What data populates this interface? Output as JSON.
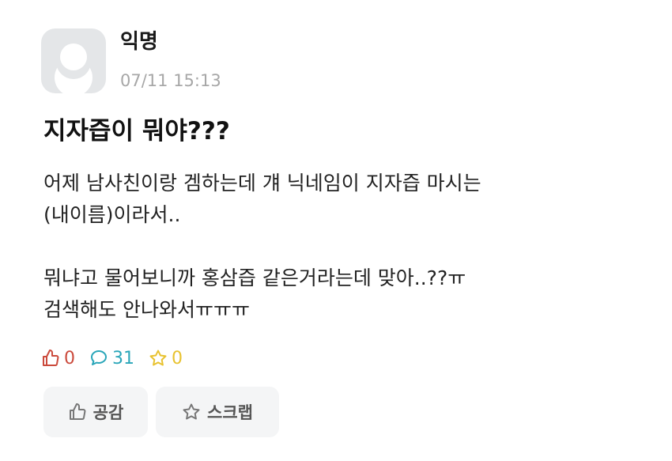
{
  "author": {
    "name": "익명",
    "time": "07/11 15:13",
    "avatar_icon": "default-profile-avatar"
  },
  "post": {
    "title": "지자즙이 뭐야???",
    "body": {
      "line1": "어제 남사친이랑 겜하는데 걔 닉네임이 지자즙 마시는",
      "line2": "(내이름)이라서..",
      "line3": "뭐냐고 물어보니까 홍삼즙 같은거라는데 맞아..??ㅠ",
      "line4": "검색해도 안나와서ㅠㅠㅠ"
    }
  },
  "stats": {
    "likes": "0",
    "like_icon": "thumbs-up-icon",
    "like_color": "#cb4a3c",
    "comments": "31",
    "comment_icon": "comment-icon",
    "comment_color": "#2aa6b9",
    "scraps": "0",
    "scrap_icon": "star-icon",
    "scrap_color": "#e8c22f"
  },
  "actions": {
    "like_label": "공감",
    "scrap_label": "스크랩"
  }
}
